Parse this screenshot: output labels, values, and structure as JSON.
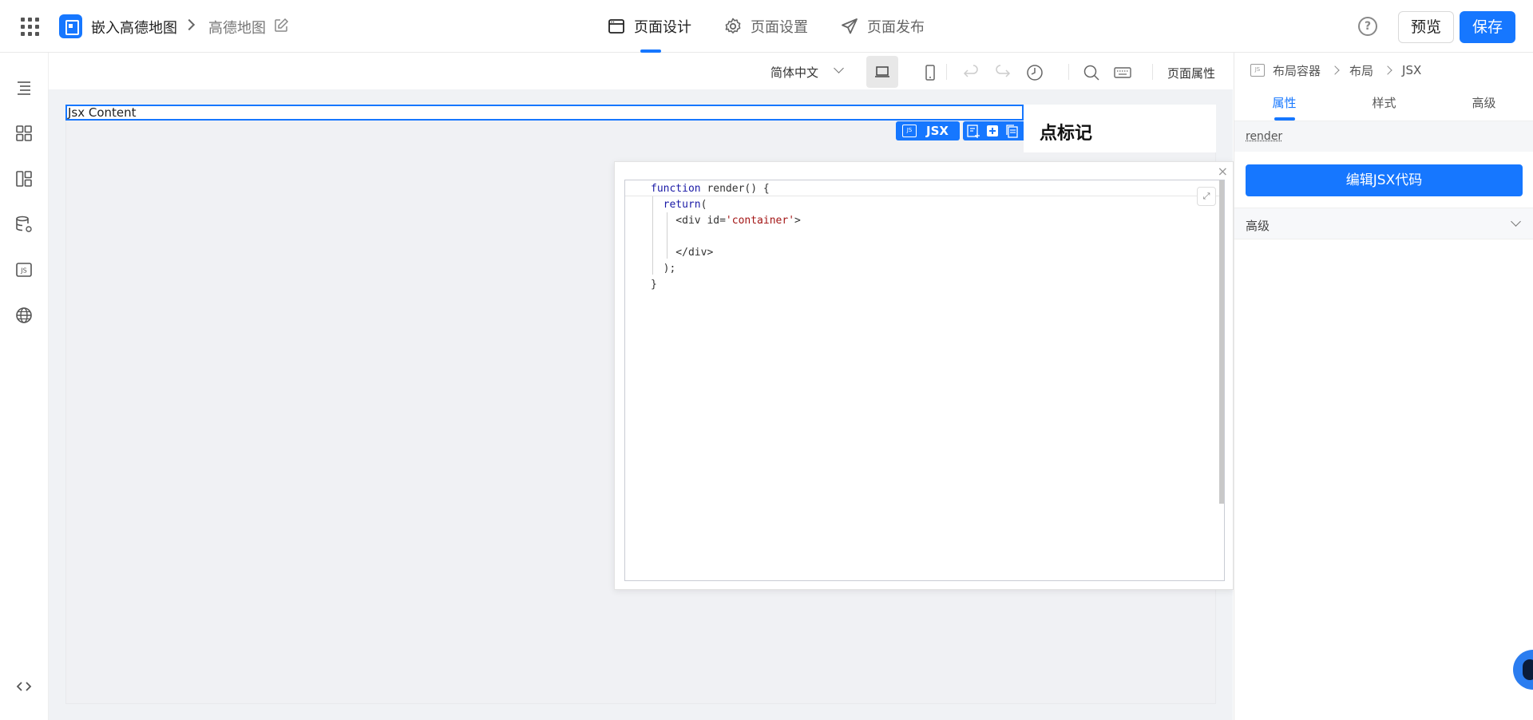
{
  "header": {
    "app_name": "嵌入高德地图",
    "page_name": "高德地图",
    "nav": [
      {
        "label": "页面设计",
        "icon": "layout-icon",
        "active": true
      },
      {
        "label": "页面设置",
        "icon": "gear-icon",
        "active": false
      },
      {
        "label": "页面发布",
        "icon": "send-icon",
        "active": false
      }
    ],
    "help_label": "?",
    "preview_label": "预览",
    "save_label": "保存"
  },
  "sidebar": {
    "items": [
      "outline-icon",
      "components-icon",
      "layout-template-icon",
      "datasource-icon",
      "js-icon",
      "globe-icon"
    ],
    "bottom": "code-icon"
  },
  "toolbar": {
    "language": "简体中文",
    "page_props": "页面属性"
  },
  "canvas": {
    "jsx_content": "Jsx Content",
    "jsx_tag": "JSX",
    "jsx_tag_icon": "JS",
    "marker_title": "点标记"
  },
  "editor": {
    "close_label": "×",
    "expand_label": "⤢",
    "lines": [
      {
        "parts": [
          {
            "t": "function",
            "c": "kw"
          },
          {
            "t": " render() {",
            "c": ""
          }
        ]
      },
      {
        "parts": [
          {
            "t": "  ",
            "c": ""
          },
          {
            "t": "return",
            "c": "kw"
          },
          {
            "t": "(",
            "c": ""
          }
        ]
      },
      {
        "parts": [
          {
            "t": "    <div id=",
            "c": ""
          },
          {
            "t": "'container'",
            "c": "str"
          },
          {
            "t": ">",
            "c": ""
          }
        ]
      },
      {
        "parts": [
          {
            "t": "",
            "c": ""
          }
        ]
      },
      {
        "parts": [
          {
            "t": "    </div>",
            "c": ""
          }
        ]
      },
      {
        "parts": [
          {
            "t": "  );",
            "c": ""
          }
        ]
      },
      {
        "parts": [
          {
            "t": "}",
            "c": ""
          }
        ]
      }
    ]
  },
  "right_panel": {
    "breadcrumb": [
      "布局容器",
      "布局",
      "JSX"
    ],
    "breadcrumb_icon": "JS",
    "tabs": [
      {
        "label": "属性",
        "active": true
      },
      {
        "label": "样式",
        "active": false
      },
      {
        "label": "高级",
        "active": false
      }
    ],
    "render_label": "render",
    "edit_button": "编辑JSX代码",
    "advanced_label": "高级"
  },
  "colors": {
    "primary": "#1677ff",
    "canvas_bg": "#f0f2f5"
  }
}
